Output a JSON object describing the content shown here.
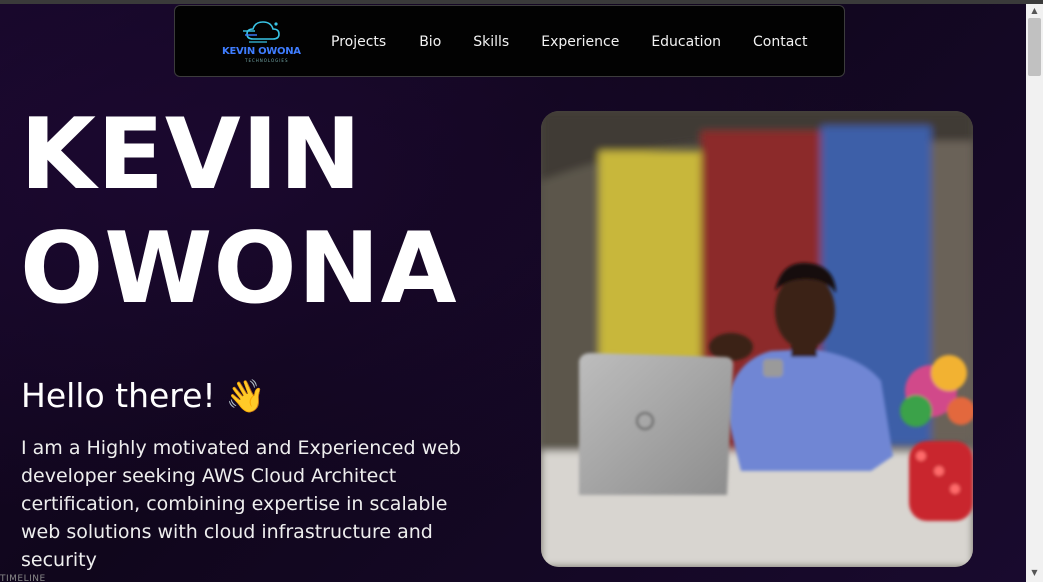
{
  "logo": {
    "text": "KEVIN OWONA",
    "subtext": "TECHNOLOGIES",
    "accent": "#3f7dff"
  },
  "nav": {
    "items": [
      {
        "label": "Projects"
      },
      {
        "label": "Bio"
      },
      {
        "label": "Skills"
      },
      {
        "label": "Experience"
      },
      {
        "label": "Education"
      },
      {
        "label": "Contact"
      }
    ]
  },
  "hero": {
    "name_line1": "KEVIN",
    "name_line2": "OWONA",
    "greeting": "Hello there!",
    "wave": "👋",
    "bio": "I am a Highly motivated and Experienced web developer seeking AWS Cloud Architect certification, combining expertise in scalable web solutions with cloud infrastructure and security"
  },
  "next_section": {
    "label": "TIMELINE"
  },
  "colors": {
    "background": "#10061c",
    "navbar": "#020202",
    "text": "#ffffff"
  }
}
